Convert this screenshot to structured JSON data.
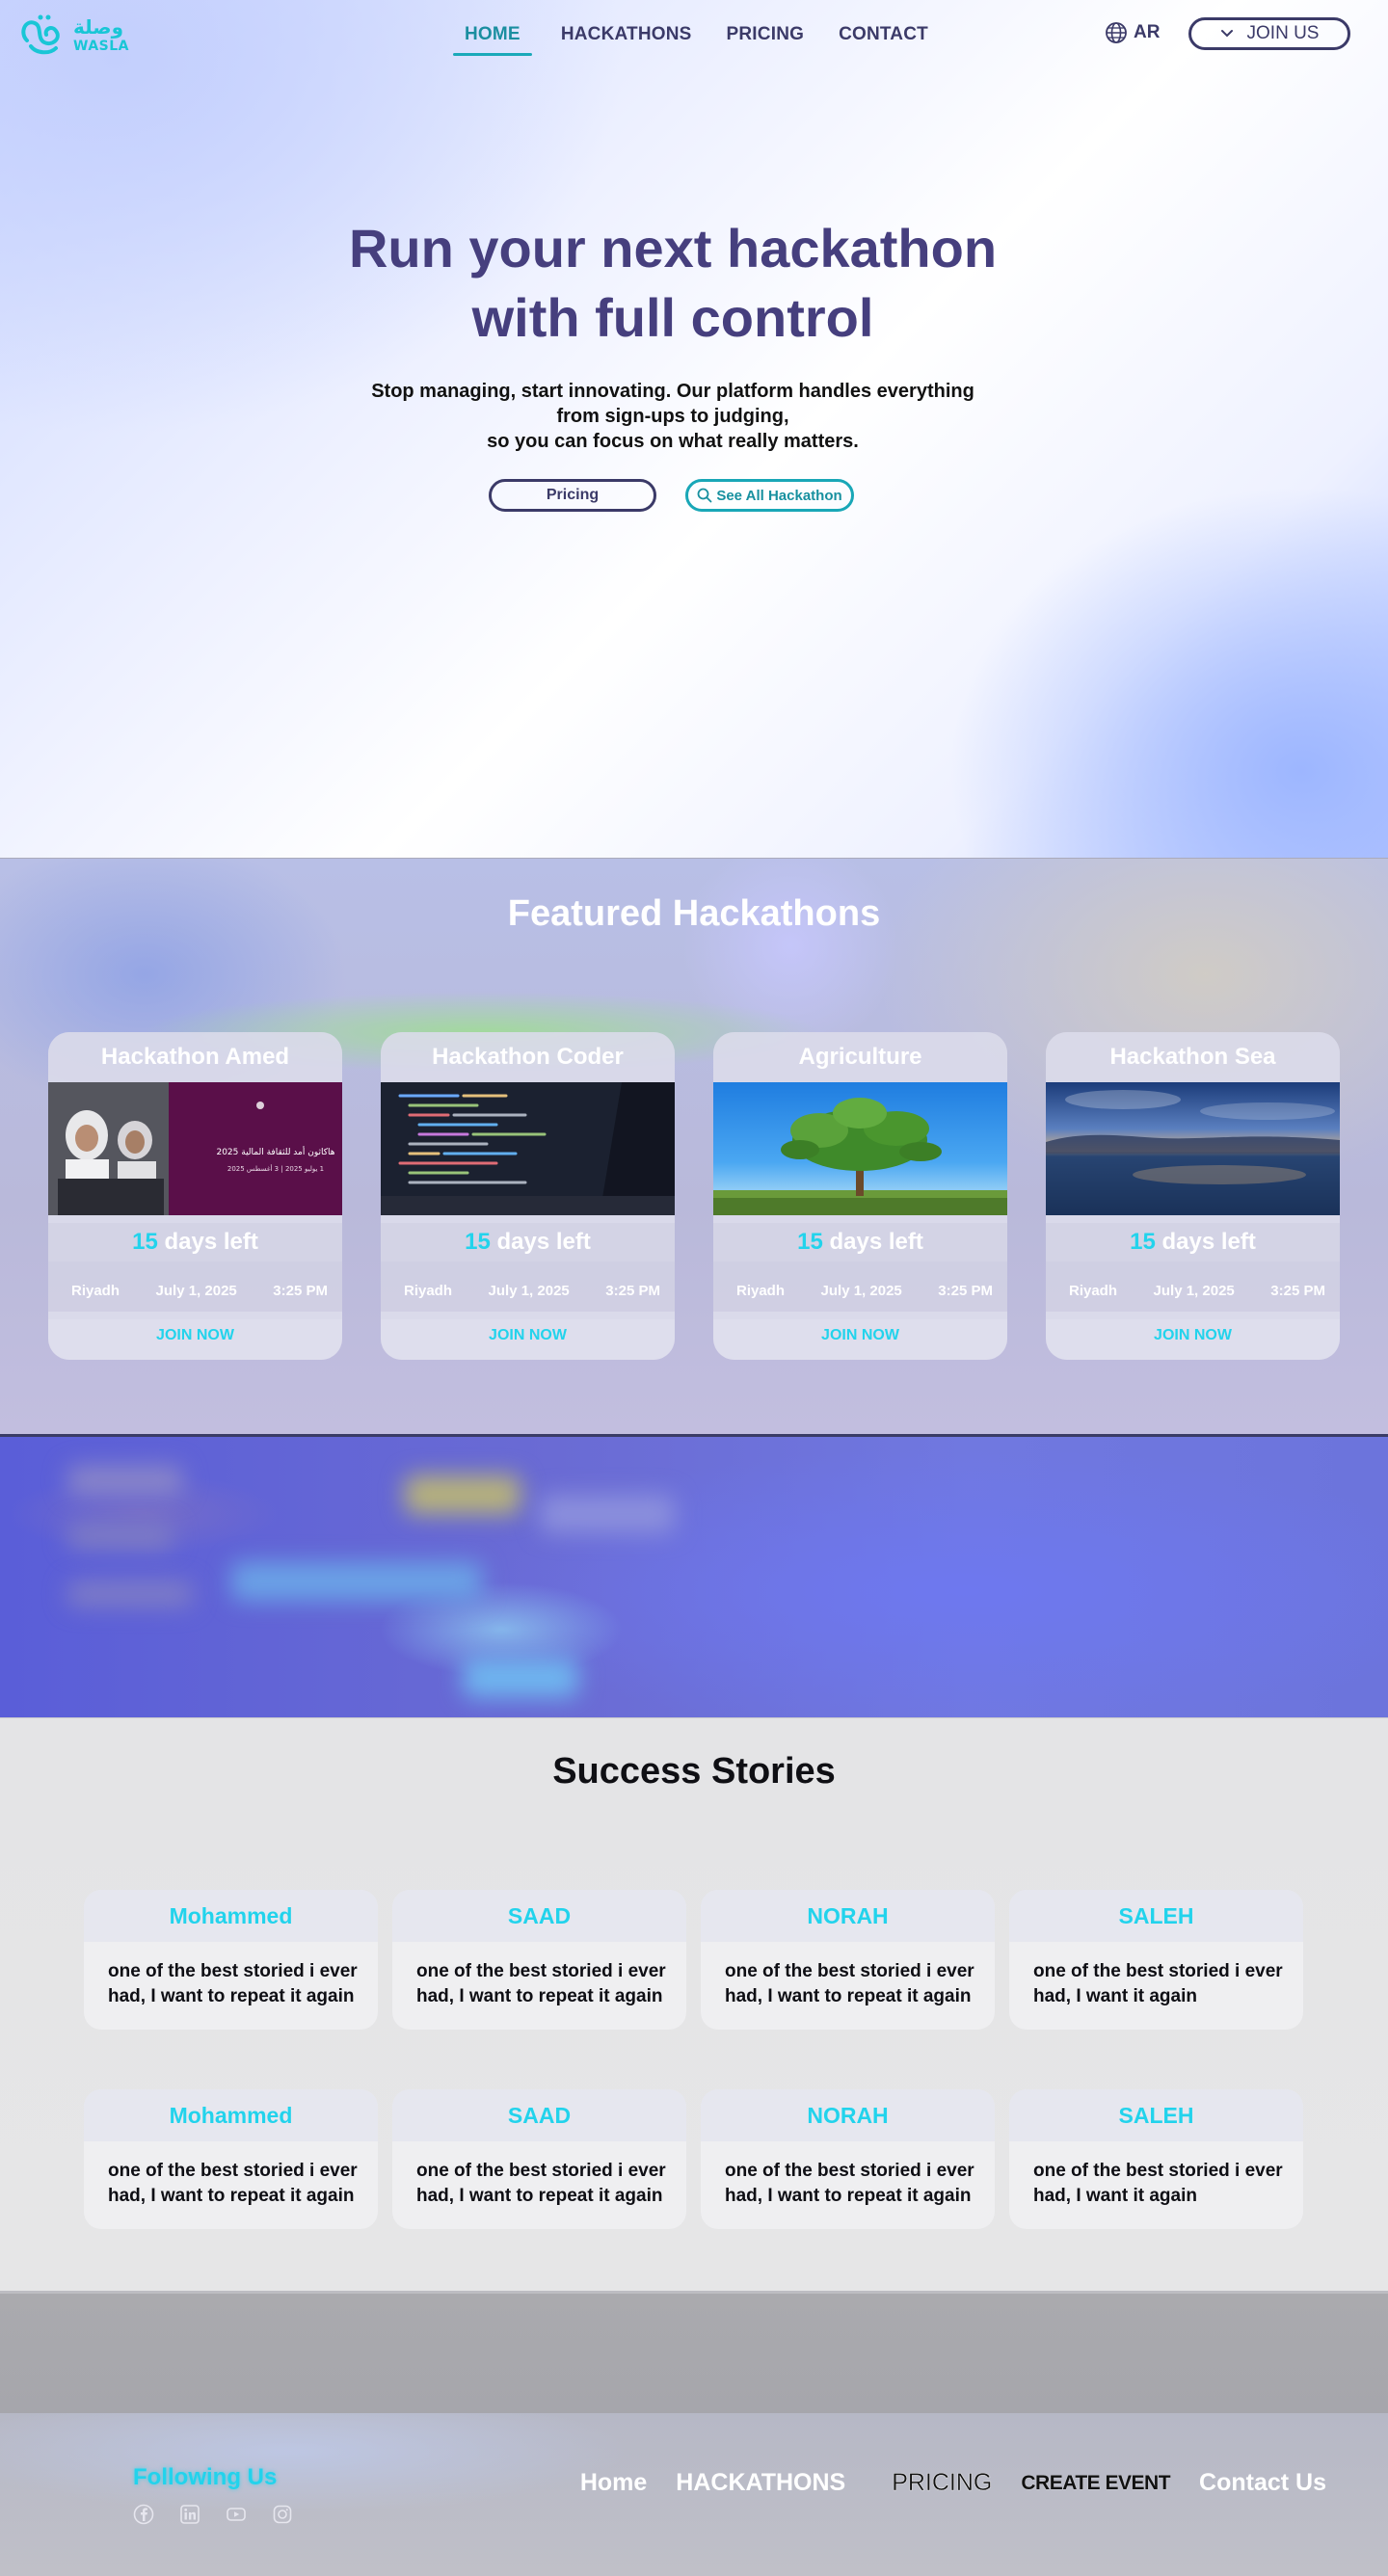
{
  "brand": {
    "name_ar": "وصلة",
    "name_en": "WASLA",
    "accent": "#22d3ec",
    "primary": "#3b3a68"
  },
  "nav": {
    "links": [
      "HOME",
      "HACKATHONS",
      "PRICING",
      "CONTACT"
    ],
    "active": "HOME",
    "lang_label": "AR",
    "join_label": "JOIN US"
  },
  "hero": {
    "title_line1": "Run your next hackathon",
    "title_line2": "with full control",
    "subtitle_line1": "Stop managing, start innovating. Our platform handles everything",
    "subtitle_line2": "from sign-ups to judging,",
    "subtitle_line3": "so you can focus on what really matters.",
    "pricing_button": "Pricing",
    "see_all_button": "See All Hackathon"
  },
  "featured": {
    "title": "Featured Hackathons",
    "cards": [
      {
        "title": "Hackathon Amed",
        "days": "15",
        "days_suffix": "days left",
        "city": "Riyadh",
        "date": "July 1, 2025",
        "time": "3:25 PM",
        "cta": "JOIN NOW",
        "img_ar_title": "هاكاثون أمد للثقافة المالية 2025",
        "img_ar_sub": "1 يوليو 2025 | 3 أغسطس 2025"
      },
      {
        "title": "Hackathon Coder",
        "days": "15",
        "days_suffix": "days left",
        "city": "Riyadh",
        "date": "July 1, 2025",
        "time": "3:25 PM",
        "cta": "JOIN NOW"
      },
      {
        "title": "Agriculture",
        "days": "15",
        "days_suffix": "days left",
        "city": "Riyadh",
        "date": "July 1, 2025",
        "time": "3:25 PM",
        "cta": "JOIN NOW"
      },
      {
        "title": "Hackathon Sea",
        "days": "15",
        "days_suffix": "days left",
        "city": "Riyadh",
        "date": "July 1, 2025",
        "time": "3:25 PM",
        "cta": "JOIN NOW"
      }
    ]
  },
  "stories": {
    "title": "Success Stories",
    "items": [
      {
        "name": "Mohammed",
        "text": "one of the best storied i ever had, I want to repeat it again"
      },
      {
        "name": "SAAD",
        "text": "one of the best storied i ever had, I want to repeat it again"
      },
      {
        "name": "NORAH",
        "text": "one of the best storied i ever had, I want to repeat it again"
      },
      {
        "name": "SALEH",
        "text": "one of the best storied i ever had, I want it again"
      },
      {
        "name": "Mohammed",
        "text": "one of the best storied i ever had, I want to repeat it again"
      },
      {
        "name": "SAAD",
        "text": "one of the best storied i ever had, I want to repeat it again"
      },
      {
        "name": "NORAH",
        "text": "one of the best storied i ever had, I want to repeat it again"
      },
      {
        "name": "SALEH",
        "text": "one of the best storied i ever had, I want it again"
      }
    ]
  },
  "footer": {
    "follow_label": "Following Us",
    "socials": [
      "facebook-icon",
      "linkedin-icon",
      "youtube-icon",
      "instagram-icon"
    ],
    "links": [
      "Home",
      "HACKATHONS",
      "PRICING",
      "CREATE EVENT",
      "Contact Us"
    ]
  }
}
